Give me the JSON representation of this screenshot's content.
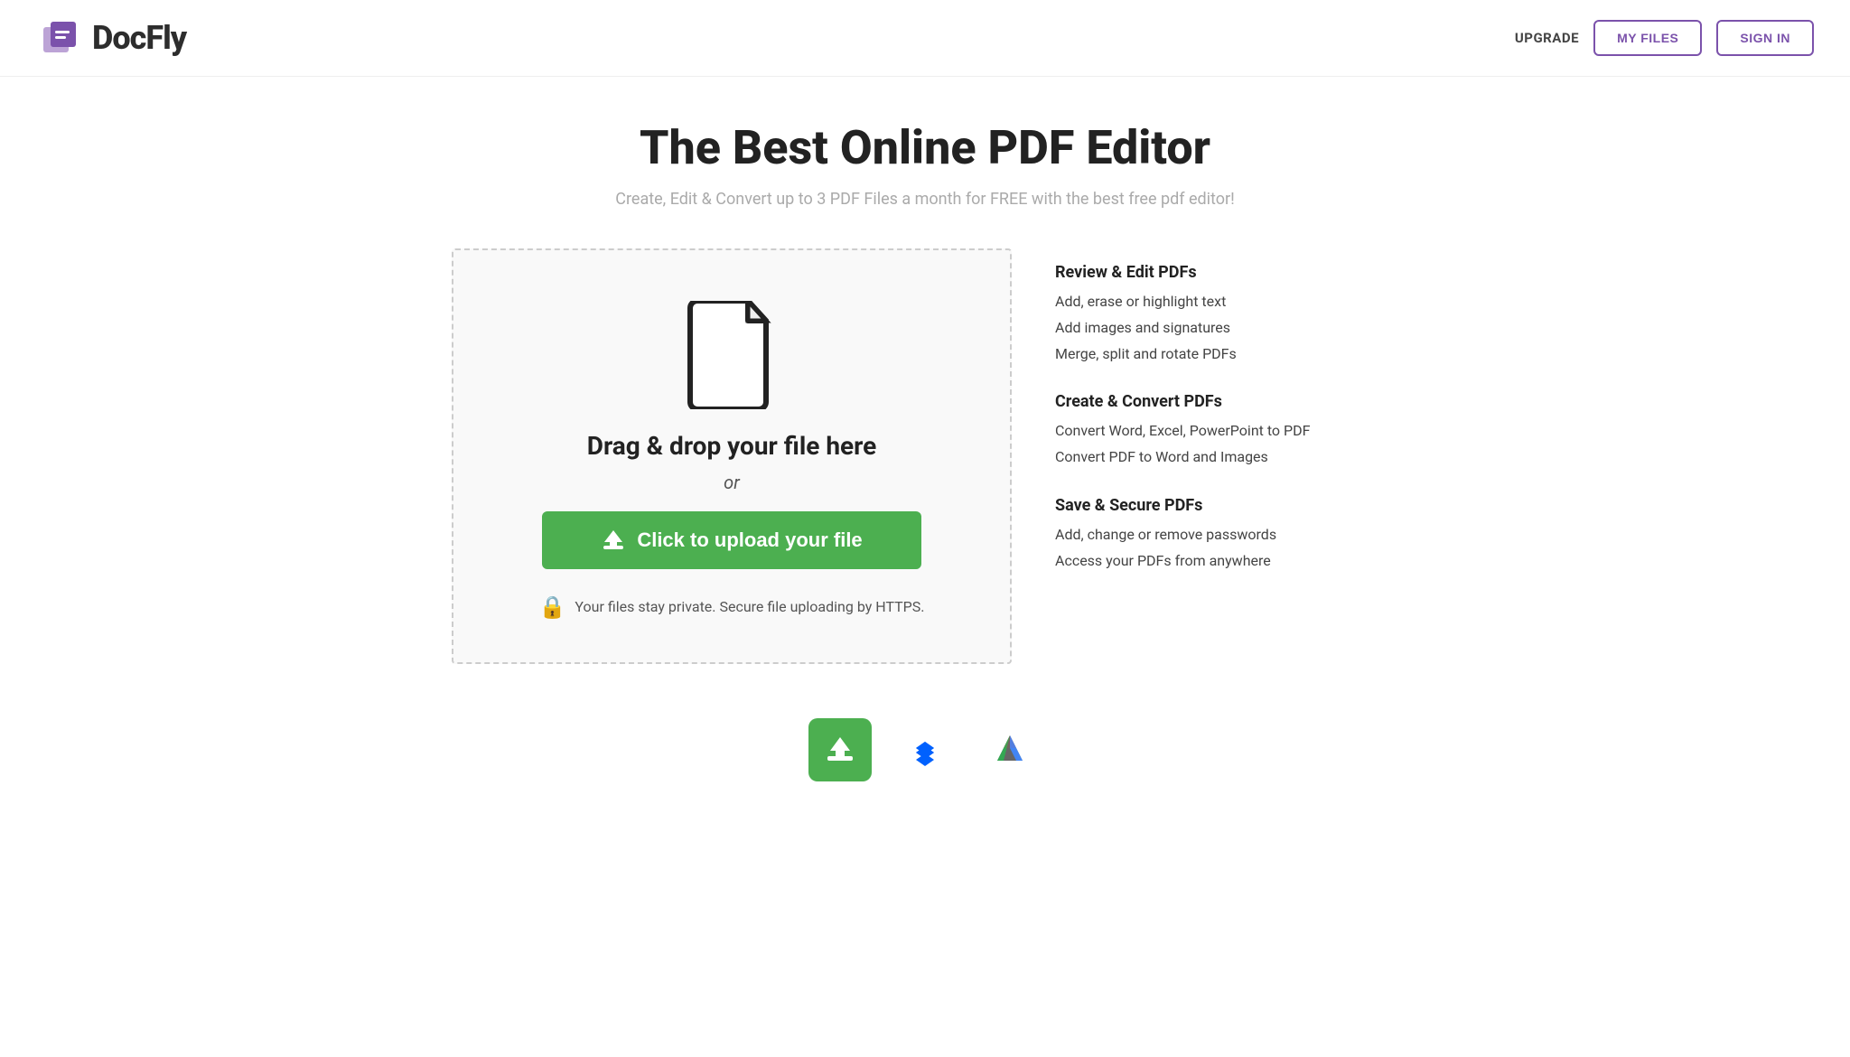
{
  "header": {
    "logo_text": "DocFly",
    "upgrade_label": "UPGRADE",
    "my_files_label": "MY FILES",
    "sign_in_label": "SIGN IN"
  },
  "hero": {
    "title": "The Best Online PDF Editor",
    "subtitle": "Create, Edit & Convert up to 3 PDF Files a month for FREE with the best free pdf editor!"
  },
  "upload_zone": {
    "drag_text": "Drag & drop your file here",
    "or_text": "or",
    "upload_btn_label": "Click to upload your file",
    "security_text": "Your files stay private. Secure file uploading by HTTPS."
  },
  "features": {
    "groups": [
      {
        "title": "Review & Edit PDFs",
        "items": [
          "Add, erase or highlight text",
          "Add images and signatures",
          "Merge, split and rotate PDFs"
        ]
      },
      {
        "title": "Create & Convert PDFs",
        "items": [
          "Convert Word, Excel, PowerPoint to PDF",
          "Convert PDF to Word and Images"
        ]
      },
      {
        "title": "Save & Secure PDFs",
        "items": [
          "Add, change or remove passwords",
          "Access your PDFs from anywhere"
        ]
      }
    ]
  },
  "bottom_icons": {
    "upload_icon": "upload",
    "dropbox_icon": "dropbox",
    "drive_icon": "google-drive"
  },
  "colors": {
    "purple": "#7b52ab",
    "green": "#4caf50",
    "text_dark": "#222222",
    "text_muted": "#aaaaaa"
  }
}
